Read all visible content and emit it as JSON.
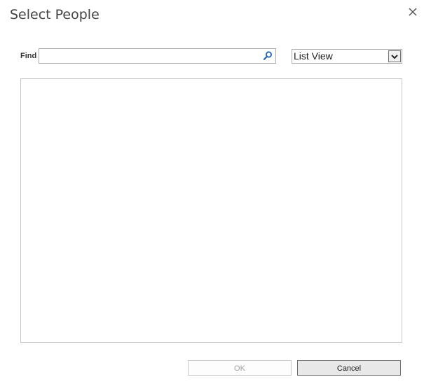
{
  "dialog": {
    "title": "Select People",
    "close_icon": "close-icon"
  },
  "search": {
    "label": "Find",
    "value": "",
    "placeholder": "",
    "icon": "search-icon"
  },
  "view": {
    "selected": "List View",
    "options": [
      "List View"
    ]
  },
  "results": {
    "items": []
  },
  "buttons": {
    "ok_label": "OK",
    "ok_enabled": false,
    "cancel_label": "Cancel"
  }
}
